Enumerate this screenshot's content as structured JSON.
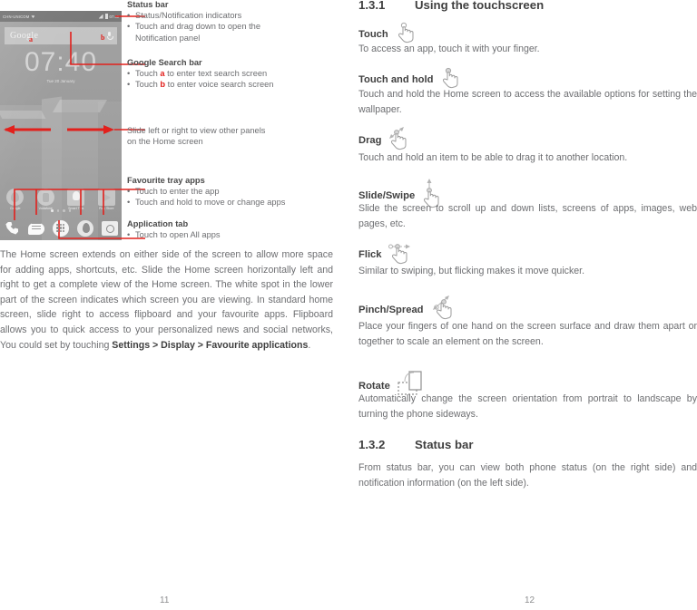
{
  "document": {
    "left_page_number": "11",
    "right_page_number": "12"
  },
  "phone_screenshot": {
    "status_bar": {
      "carrier": "CHN-UNICOM",
      "time": "07:40"
    },
    "search_bar": {
      "logo_text": "Google",
      "label_a": "a",
      "label_b": "b"
    },
    "clock": {
      "time": "07:40",
      "date": "Tue 20 January"
    },
    "apps": [
      {
        "name": "Google",
        "icon": "chrome-icon"
      },
      {
        "name": "Vodafone",
        "icon": "vodafone-icon"
      },
      {
        "name": "Smart Tips",
        "icon": "bulb-icon"
      },
      {
        "name": "Play Store",
        "icon": "play-store-icon"
      }
    ],
    "dock": [
      {
        "name": "phone-icon"
      },
      {
        "name": "messaging-icon"
      },
      {
        "name": "all-apps-icon"
      },
      {
        "name": "chrome-icon"
      },
      {
        "name": "camera-icon"
      }
    ],
    "page_dots": 4,
    "active_dot": 1
  },
  "annotations": {
    "status_bar": {
      "title": "Status bar",
      "items": [
        "Status/Notification indicators",
        "Touch and drag down to open the",
        "Notification panel"
      ]
    },
    "google_search_bar": {
      "title": "Google Search bar",
      "item1_pre": "Touch ",
      "item1_mark": "a",
      "item1_post": " to enter text search screen",
      "item2_pre": "Touch ",
      "item2_mark": "b",
      "item2_post": " to enter voice search screen"
    },
    "slide_panels": {
      "line1": "Slide left or right to view other panels",
      "line2": "on the Home screen"
    },
    "favourite_tray": {
      "title": "Favourite tray apps",
      "items": [
        "Touch to enter the app",
        "Touch and hold to move or change apps"
      ]
    },
    "application_tab": {
      "title": "Application tab",
      "items": [
        "Touch to open All apps"
      ]
    }
  },
  "left_body": {
    "text_before_bold": "The Home screen extends on either side of the screen to allow more space for adding apps, shortcuts, etc. Slide the Home screen horizontally left and right to get a complete view of the Home screen. The white spot in the lower part of the screen indicates which screen you are viewing. In standard home screen, slide right to access flipboard and your favourite apps. Flipboard allows you to quick access to your personalized news and social networks, You could set by touching ",
    "bold_1": "Settings > Display > Favourite applications",
    "text_after_bold": "."
  },
  "right_column": {
    "section_131": {
      "number": "1.3.1",
      "title": "Using the touchscreen"
    },
    "touch": {
      "heading": "Touch",
      "icon": "touch-hand-icon",
      "body": "To access an app, touch it with your finger."
    },
    "touch_and_hold": {
      "heading": "Touch and hold",
      "icon": "touch-hold-hand-icon",
      "body": "Touch and hold the Home screen to access the available options for setting the wallpaper."
    },
    "drag": {
      "heading": "Drag",
      "icon": "drag-hand-icon",
      "body": "Touch and hold an item to be able to drag it to another location."
    },
    "slide_swipe": {
      "heading": "Slide/Swipe",
      "icon": "swipe-hand-icon",
      "body": "Slide the screen to scroll up and down lists, screens of apps, images, web pages, etc."
    },
    "flick": {
      "heading": "Flick",
      "icon": "flick-hand-icon",
      "body": "Similar to swiping, but flicking makes it move quicker."
    },
    "pinch_spread": {
      "heading": "Pinch/Spread",
      "icon": "pinch-hand-icon",
      "body": "Place your fingers of one hand on the screen surface and draw them apart or together to scale an element on the screen."
    },
    "rotate": {
      "heading": "Rotate",
      "icon": "rotate-phone-icon",
      "body": "Automatically change the screen orientation from portrait to landscape by turning the phone sideways."
    },
    "section_132": {
      "number": "1.3.2",
      "title": "Status bar",
      "body": "From status bar, you can view both phone status (on the right side) and notification information (on the left side)."
    }
  },
  "colors": {
    "accent_red": "#e2201c",
    "heading_grey": "#3f3f3f",
    "body_grey": "#6d6e71"
  }
}
